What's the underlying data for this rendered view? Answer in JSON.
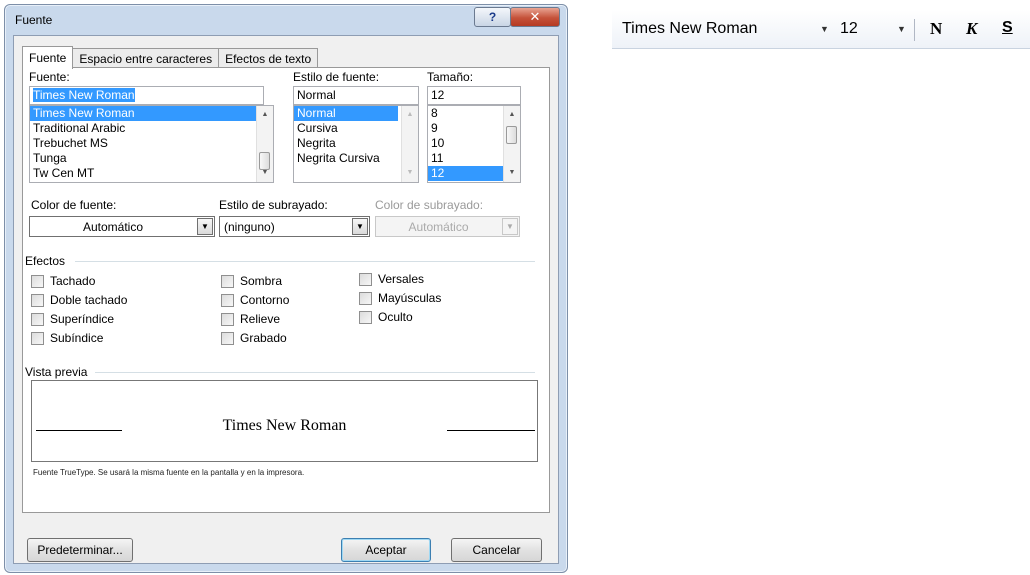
{
  "window": {
    "title": "Fuente",
    "help_glyph": "?",
    "close_glyph": "✕"
  },
  "tabs": [
    {
      "label": "Fuente",
      "active": true
    },
    {
      "label": "Espacio entre caracteres",
      "active": false
    },
    {
      "label": "Efectos de texto",
      "active": false
    }
  ],
  "font": {
    "label": "Fuente:",
    "value": "Times New Roman",
    "options": [
      "Times New Roman",
      "Traditional Arabic",
      "Trebuchet MS",
      "Tunga",
      "Tw Cen MT"
    ],
    "selected": "Times New Roman"
  },
  "style": {
    "label": "Estilo de fuente:",
    "value": "Normal",
    "options": [
      "Normal",
      "Cursiva",
      "Negrita",
      "Negrita Cursiva"
    ],
    "selected": "Normal"
  },
  "size": {
    "label": "Tamaño:",
    "value": "12",
    "options": [
      "8",
      "9",
      "10",
      "11",
      "12"
    ],
    "selected": "12"
  },
  "font_color": {
    "label": "Color de fuente:",
    "value": "Automático"
  },
  "underline_style": {
    "label": "Estilo de subrayado:",
    "value": "(ninguno)"
  },
  "underline_color": {
    "label": "Color de subrayado:",
    "value": "Automático",
    "disabled": true
  },
  "effects": {
    "title": "Efectos",
    "col1": [
      "Tachado",
      "Doble tachado",
      "Superíndice",
      "Subíndice"
    ],
    "col2": [
      "Sombra",
      "Contorno",
      "Relieve",
      "Grabado"
    ],
    "col3": [
      "Versales",
      "Mayúsculas",
      "Oculto"
    ]
  },
  "preview": {
    "title": "Vista previa",
    "sample": "Times New Roman",
    "note": "Fuente TrueType. Se usará la misma fuente en la pantalla y en la impresora."
  },
  "buttons": {
    "default_label": "Predeterminar...",
    "ok_label": "Aceptar",
    "cancel_label": "Cancelar"
  },
  "toolbar": {
    "font_name": "Times New Roman",
    "font_size": "12",
    "dropdown_glyph": "▼",
    "bold_label": "N",
    "italic_label": "K",
    "underline_label": "S"
  },
  "colors": {
    "selection": "#3399ff",
    "dialog_frame": "#c9d9ec",
    "close_button": "#c5523a"
  }
}
